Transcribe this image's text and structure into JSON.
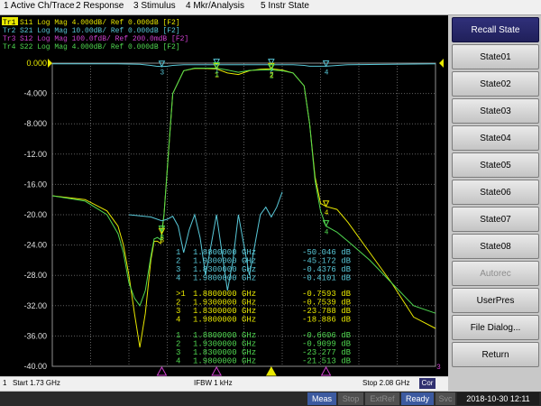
{
  "menu": {
    "items": [
      "1 Active Ch/Trace",
      "2 Response",
      "3 Stimulus",
      "4 Mkr/Analysis",
      "5 Instr State"
    ]
  },
  "traces": [
    {
      "id": "Tr1",
      "label": "S11 Log Mag 4.000dB/ Ref 0.000dB [F2]",
      "color": "#e8e800"
    },
    {
      "id": "Tr2",
      "label": "S21 Log Mag 10.00dB/ Ref 0.000dB [F2]",
      "color": "#58c8d8"
    },
    {
      "id": "Tr3",
      "label": "S12 Log Mag 100.0fdB/ Ref 200.0mdB [F2]",
      "color": "#d040d0"
    },
    {
      "id": "Tr4",
      "label": "S22 Log Mag 4.000dB/ Ref 0.000dB [F2]",
      "color": "#50d850"
    }
  ],
  "scale": {
    "ticks": [
      "0.000",
      "-4.000",
      "-8.000",
      "-12.00",
      "-16.00",
      "-20.00",
      "-24.00",
      "-28.00",
      "-32.00",
      "-36.00",
      "-40.00"
    ]
  },
  "marker_tables": [
    {
      "trace": "Tr2",
      "color": "#58c8d8",
      "rows": [
        {
          "id": "1",
          "freq": "1.8800000 GHz",
          "value": "-50.046 dB"
        },
        {
          "id": "2",
          "freq": "1.9300000 GHz",
          "value": "-45.172 dB"
        },
        {
          "id": "3",
          "freq": "1.8300000 GHz",
          "value": "-0.4376 dB"
        },
        {
          "id": "4",
          "freq": "1.9800000 GHz",
          "value": "-0.4101 dB"
        }
      ]
    },
    {
      "trace": "Tr1",
      "color": "#e8e800",
      "rows": [
        {
          "id": ">1",
          "freq": "1.8800000 GHz",
          "value": "-0.7593 dB"
        },
        {
          "id": "2",
          "freq": "1.9300000 GHz",
          "value": "-0.7539 dB"
        },
        {
          "id": "3",
          "freq": "1.8300000 GHz",
          "value": "-23.788 dB"
        },
        {
          "id": "4",
          "freq": "1.9800000 GHz",
          "value": "-18.886 dB"
        }
      ]
    },
    {
      "trace": "Tr4",
      "color": "#50d850",
      "rows": [
        {
          "id": "1",
          "freq": "1.8800000 GHz",
          "value": "-0.6606 dB"
        },
        {
          "id": "2",
          "freq": "1.9300000 GHz",
          "value": "-0.9099 dB"
        },
        {
          "id": "3",
          "freq": "1.8300000 GHz",
          "value": "-23.277 dB"
        },
        {
          "id": "4",
          "freq": "1.9800000 GHz",
          "value": "-21.513 dB"
        }
      ]
    }
  ],
  "softkeys": {
    "title": "Recall State",
    "items": [
      {
        "label": "State01",
        "enabled": true
      },
      {
        "label": "State02",
        "enabled": true
      },
      {
        "label": "State03",
        "enabled": true
      },
      {
        "label": "State04",
        "enabled": true
      },
      {
        "label": "State05",
        "enabled": true
      },
      {
        "label": "State06",
        "enabled": true
      },
      {
        "label": "State07",
        "enabled": true
      },
      {
        "label": "State08",
        "enabled": true
      },
      {
        "label": "Autorec",
        "enabled": false
      },
      {
        "label": "UserPres",
        "enabled": true
      },
      {
        "label": "File Dialog...",
        "enabled": true
      },
      {
        "label": "Return",
        "enabled": true
      }
    ]
  },
  "channel_bar": {
    "channel": "1",
    "start": "Start 1.73 GHz",
    "ifbw": "IFBW 1 kHz",
    "stop": "Stop 2.08 GHz",
    "cor": "Cor"
  },
  "status_bar": {
    "meas": "Meas",
    "stop": "Stop",
    "extref": "ExtRef",
    "ready": "Ready",
    "svc": "Svc",
    "datetime": "2018-10-30 12:11"
  },
  "chart_data": {
    "type": "line",
    "x_unit": "GHz",
    "xlim": [
      1.73,
      2.08
    ],
    "ylim": [
      -40,
      0
    ],
    "grid": true,
    "series": [
      {
        "name": "S11",
        "color": "#e8e800",
        "x": [
          1.73,
          1.76,
          1.78,
          1.79,
          1.795,
          1.8,
          1.805,
          1.81,
          1.815,
          1.82,
          1.823,
          1.826,
          1.829,
          1.832,
          1.836,
          1.84,
          1.85,
          1.86,
          1.87,
          1.88,
          1.89,
          1.9,
          1.91,
          1.92,
          1.93,
          1.94,
          1.95,
          1.96,
          1.965,
          1.97,
          1.975,
          1.98,
          1.99,
          2.0,
          2.02,
          2.04,
          2.06,
          2.08
        ],
        "y": [
          -17.5,
          -18,
          -19.5,
          -21.5,
          -24,
          -28,
          -33,
          -37.5,
          -33,
          -26,
          -23.5,
          -23.5,
          -23.8,
          -20,
          -12,
          -4,
          -1,
          -0.7,
          -0.7,
          -0.76,
          -1.3,
          -1.5,
          -1,
          -0.8,
          -0.75,
          -0.9,
          -1.3,
          -3,
          -8,
          -15,
          -18.5,
          -18.9,
          -19.3,
          -21,
          -25,
          -29,
          -33.5,
          -35
        ]
      },
      {
        "name": "S21",
        "color": "#58c8d8",
        "x": [
          1.73,
          1.79,
          1.81,
          1.82,
          1.825,
          1.83,
          1.835,
          1.84,
          1.85,
          1.9,
          1.95,
          1.96,
          1.965,
          1.97,
          1.98,
          2.0,
          2.08
        ],
        "y": [
          -0.1,
          -0.1,
          -0.15,
          -0.3,
          -0.4,
          -0.44,
          -0.4,
          -0.3,
          -0.2,
          -0.2,
          -0.2,
          -0.3,
          -0.4,
          -0.4,
          -0.41,
          -0.2,
          -0.1
        ]
      },
      {
        "name": "S22",
        "color": "#50d850",
        "x": [
          1.73,
          1.76,
          1.78,
          1.79,
          1.795,
          1.8,
          1.805,
          1.81,
          1.815,
          1.82,
          1.823,
          1.826,
          1.829,
          1.832,
          1.836,
          1.84,
          1.85,
          1.86,
          1.87,
          1.88,
          1.89,
          1.9,
          1.91,
          1.92,
          1.93,
          1.94,
          1.95,
          1.96,
          1.965,
          1.97,
          1.975,
          1.98,
          1.99,
          2.0,
          2.02,
          2.04,
          2.06,
          2.08
        ],
        "y": [
          -17.5,
          -18.2,
          -20,
          -22.5,
          -25,
          -29,
          -31,
          -32,
          -30,
          -25.5,
          -23.2,
          -23,
          -23.3,
          -20,
          -12,
          -4,
          -1,
          -0.65,
          -0.65,
          -0.66,
          -0.9,
          -1.2,
          -0.95,
          -0.9,
          -0.91,
          -1,
          -1.3,
          -3,
          -8,
          -15.5,
          -19.5,
          -21.5,
          -22.3,
          -23.5,
          -26,
          -29,
          -32,
          -33
        ]
      },
      {
        "name": "S21 (stopband)",
        "color": "#58c8d8",
        "x": [
          1.8,
          1.82,
          1.83,
          1.835,
          1.84,
          1.845,
          1.85,
          1.855,
          1.86,
          1.865,
          1.87,
          1.875,
          1.88,
          1.885,
          1.89,
          1.895,
          1.9,
          1.905,
          1.91,
          1.915,
          1.92,
          1.925,
          1.93,
          1.935,
          1.94
        ],
        "y": [
          -20,
          -20.3,
          -20.8,
          -20.6,
          -20.2,
          -21.5,
          -25,
          -22,
          -20,
          -23,
          -28,
          -24,
          -20,
          -25,
          -30,
          -26,
          -20,
          -24,
          -28,
          -24,
          -20,
          -19,
          -20.3,
          -19,
          -17
        ]
      }
    ],
    "markers": [
      {
        "trace": "S21",
        "ids": [
          "1",
          "2",
          "3",
          "4"
        ],
        "x": [
          1.88,
          1.93,
          1.83,
          1.98
        ]
      },
      {
        "trace": "S11",
        "ids": [
          "1",
          "2",
          "3",
          "4"
        ],
        "x": [
          1.88,
          1.93,
          1.83,
          1.98
        ]
      },
      {
        "trace": "S22",
        "ids": [
          "1",
          "2",
          "3",
          "4"
        ],
        "x": [
          1.88,
          1.93,
          1.83,
          1.98
        ]
      }
    ]
  }
}
